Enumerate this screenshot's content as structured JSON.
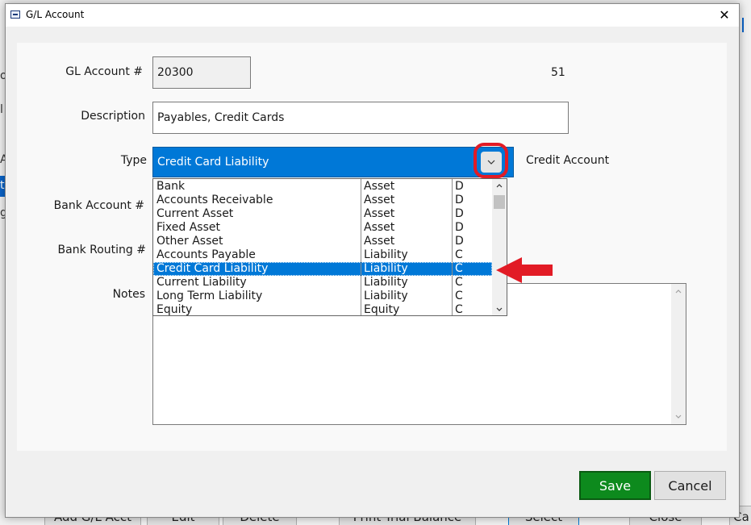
{
  "background": {
    "fragments": [
      "o",
      "l",
      "A",
      "t",
      "g"
    ],
    "bottom_buttons": [
      "Add G/L Acct",
      "Edit",
      "Delete",
      "Print Trial Balance",
      "Select",
      "Close",
      "Ca"
    ]
  },
  "dialog": {
    "title": "G/L Account",
    "title_icon": "form-icon",
    "close_label": "✕"
  },
  "form": {
    "gl_account_label": "GL Account #",
    "gl_account_value": "20300",
    "gl_count": "51",
    "description_label": "Description",
    "description_value": "Payables, Credit Cards",
    "type_label": "Type",
    "type_value": "Credit Card Liability",
    "type_side_label": "Credit Account",
    "bank_account_label": "Bank Account #",
    "bank_routing_label": "Bank Routing #",
    "notes_label": "Notes"
  },
  "type_dropdown": {
    "selected_index": 6,
    "options": [
      {
        "name": "Bank",
        "category": "Asset",
        "side": "D"
      },
      {
        "name": "Accounts Receivable",
        "category": "Asset",
        "side": "D"
      },
      {
        "name": "Current Asset",
        "category": "Asset",
        "side": "D"
      },
      {
        "name": "Fixed Asset",
        "category": "Asset",
        "side": "D"
      },
      {
        "name": "Other Asset",
        "category": "Asset",
        "side": "D"
      },
      {
        "name": "Accounts Payable",
        "category": "Liability",
        "side": "C"
      },
      {
        "name": "Credit Card Liability",
        "category": "Liability",
        "side": "C"
      },
      {
        "name": "Current Liability",
        "category": "Liability",
        "side": "C"
      },
      {
        "name": "Long Term Liability",
        "category": "Liability",
        "side": "C"
      },
      {
        "name": "Equity",
        "category": "Equity",
        "side": "C"
      }
    ]
  },
  "buttons": {
    "save_label": "Save",
    "cancel_label": "Cancel"
  },
  "colors": {
    "accent": "#0078d7",
    "save_green": "#0d8a1d",
    "annotation_red": "#e21b25"
  }
}
